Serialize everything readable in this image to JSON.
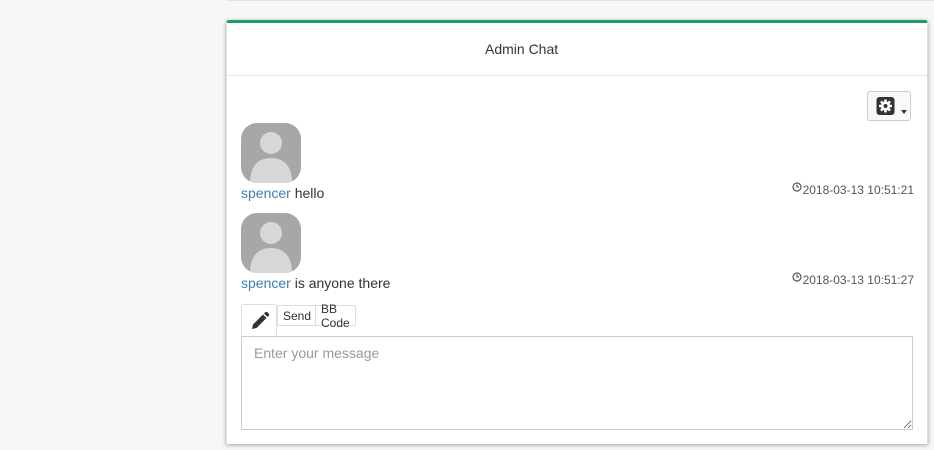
{
  "panel": {
    "title": "Admin Chat"
  },
  "settings": {
    "icon": "gear-icon",
    "dropdown": "caret-down-icon"
  },
  "messages": [
    {
      "user": "spencer",
      "text": "hello",
      "timestamp": "2018-03-13 10:51:21"
    },
    {
      "user": "spencer",
      "text": "is anyone there",
      "timestamp": "2018-03-13 10:51:27"
    }
  ],
  "composer": {
    "pencil_icon": "pencil-icon",
    "send_label": "Send",
    "bbcode_label": "BB Code",
    "placeholder": "Enter your message",
    "value": ""
  },
  "colors": {
    "accent": "#1d9d5f",
    "username": "#3a7fb8",
    "avatar": "#a5a7a9"
  }
}
